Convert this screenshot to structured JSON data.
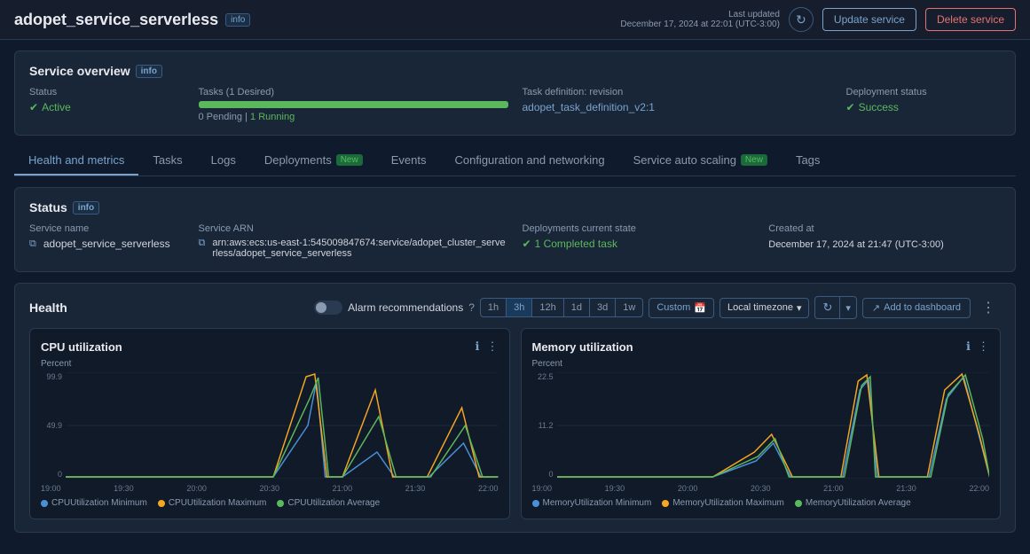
{
  "header": {
    "title": "adopet_service_serverless",
    "info_badge": "info",
    "last_updated_label": "Last updated",
    "last_updated_value": "December 17, 2024 at 22:01 (UTC-3:00)",
    "refresh_icon": "↻",
    "update_service_btn": "Update service",
    "delete_service_btn": "Delete service"
  },
  "service_overview": {
    "section_title": "Service overview",
    "info_badge": "info",
    "status_label": "Status",
    "status_value": "Active",
    "tasks_label": "Tasks (1 Desired)",
    "tasks_pending": "0 Pending",
    "tasks_separator": "|",
    "tasks_running": "1 Running",
    "task_def_label": "Task definition: revision",
    "task_def_value": "adopet_task_definition_v2:1",
    "deployment_status_label": "Deployment status",
    "deployment_status_value": "Success"
  },
  "tabs": [
    {
      "id": "health",
      "label": "Health and metrics",
      "active": true,
      "new": false
    },
    {
      "id": "tasks",
      "label": "Tasks",
      "active": false,
      "new": false
    },
    {
      "id": "logs",
      "label": "Logs",
      "active": false,
      "new": false
    },
    {
      "id": "deployments",
      "label": "Deployments",
      "active": false,
      "new": true
    },
    {
      "id": "events",
      "label": "Events",
      "active": false,
      "new": false
    },
    {
      "id": "configuration",
      "label": "Configuration and networking",
      "active": false,
      "new": false
    },
    {
      "id": "autoscaling",
      "label": "Service auto scaling",
      "active": false,
      "new": true
    },
    {
      "id": "tags",
      "label": "Tags",
      "active": false,
      "new": false
    }
  ],
  "status_section": {
    "section_title": "Status",
    "info_badge": "info",
    "service_name_label": "Service name",
    "service_name_value": "adopet_service_serverless",
    "service_arn_label": "Service ARN",
    "service_arn_value": "arn:aws:ecs:us-east-1:545009847674:service/adopet_cluster_serverless/adopet_service_serverless",
    "deployments_label": "Deployments current state",
    "deployments_value": "1 Completed task",
    "created_at_label": "Created at",
    "created_at_value": "December 17, 2024 at 21:47 (UTC-3:00)"
  },
  "health_section": {
    "section_title": "Health",
    "alarm_label": "Alarm recommendations",
    "time_ranges": [
      "1h",
      "3h",
      "12h",
      "1d",
      "3d",
      "1w"
    ],
    "active_time_range": "3h",
    "custom_btn": "Custom",
    "timezone_label": "Local timezone",
    "add_dashboard_btn": "Add to dashboard"
  },
  "cpu_chart": {
    "title": "CPU utilization",
    "y_label": "Percent",
    "y_max": "99.9",
    "y_mid": "49.9",
    "y_min": "0",
    "x_labels": [
      "19:00",
      "19:30",
      "20:00",
      "20:30",
      "21:00",
      "21:30",
      "22:00"
    ],
    "legend": [
      {
        "label": "CPUUtilization Minimum",
        "color": "#4a90d9"
      },
      {
        "label": "CPUUtilization Maximum",
        "color": "#f5a623"
      },
      {
        "label": "CPUUtilization Average",
        "color": "#5cb85c"
      }
    ]
  },
  "memory_chart": {
    "title": "Memory utilization",
    "y_label": "Percent",
    "y_max": "22.5",
    "y_mid": "11.2",
    "y_min": "0",
    "x_labels": [
      "19:00",
      "19:30",
      "20:00",
      "20:30",
      "21:00",
      "21:30",
      "22:00"
    ],
    "legend": [
      {
        "label": "MemoryUtilization Minimum",
        "color": "#4a90d9"
      },
      {
        "label": "MemoryUtilization Maximum",
        "color": "#f5a623"
      },
      {
        "label": "MemoryUtilization Average",
        "color": "#5cb85c"
      }
    ]
  }
}
